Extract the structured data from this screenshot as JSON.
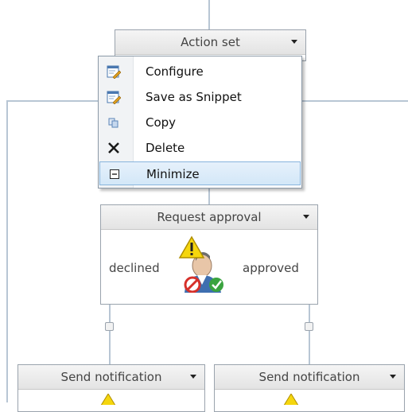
{
  "action_set": {
    "title": "Action set"
  },
  "context_menu": {
    "items": [
      {
        "label": "Configure",
        "icon": "configure-icon"
      },
      {
        "label": "Save as Snippet",
        "icon": "save-snippet-icon"
      },
      {
        "label": "Copy",
        "icon": "copy-icon"
      },
      {
        "label": "Delete",
        "icon": "delete-icon"
      },
      {
        "label": "Minimize",
        "icon": "minimize-icon",
        "highlighted": true
      }
    ]
  },
  "request_approval": {
    "title": "Request approval",
    "left_branch": "declined",
    "right_branch": "approved",
    "icon": "request-approval-icon"
  },
  "send_notification_left": {
    "title": "Send notification",
    "icon": "warning-icon"
  },
  "send_notification_right": {
    "title": "Send notification",
    "icon": "warning-icon"
  },
  "colors": {
    "connector": "#b8c6d4",
    "menu_highlight": "#d3e7f8",
    "warning": "#f5d60e"
  }
}
